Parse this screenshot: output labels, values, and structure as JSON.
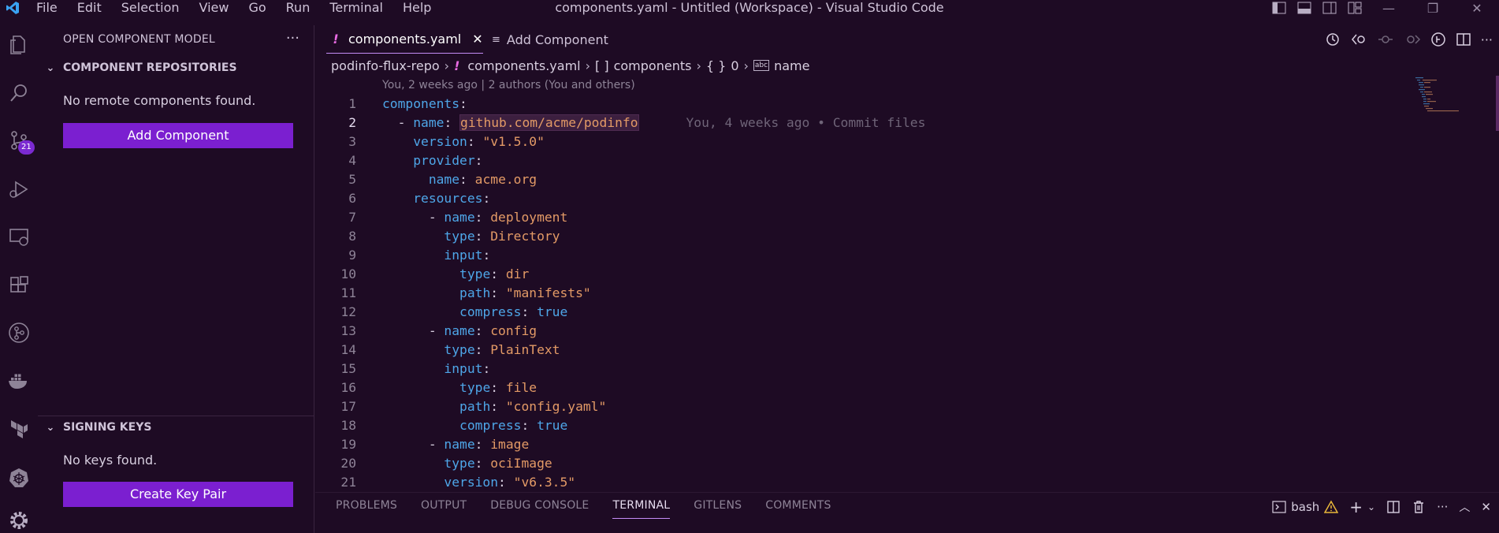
{
  "titlebar": {
    "menu": [
      "File",
      "Edit",
      "Selection",
      "View",
      "Go",
      "Run",
      "Terminal",
      "Help"
    ],
    "window_title": "components.yaml - Untitled (Workspace) - Visual Studio Code"
  },
  "activity_bar": {
    "icons": [
      "explorer-icon",
      "search-icon",
      "source-control-icon",
      "run-debug-icon",
      "remote-explorer-icon",
      "extensions-icon",
      "gitlens-icon",
      "docker-icon",
      "terraform-icon",
      "kubernetes-icon",
      "settings-gear-icon"
    ],
    "scm_badge": "21"
  },
  "sidebar": {
    "title": "OPEN COMPONENT MODEL",
    "more": "···",
    "repos": {
      "header": "COMPONENT REPOSITORIES",
      "empty_message": "No remote components found.",
      "button": "Add Component"
    },
    "keys": {
      "header": "SIGNING KEYS",
      "empty_message": "No keys found.",
      "button": "Create Key Pair"
    }
  },
  "editor": {
    "tabs": [
      {
        "label": "components.yaml",
        "marker": "!"
      },
      {
        "label": "Add Component"
      }
    ],
    "breadcrumb": {
      "repo": "podinfo-flux-repo",
      "file_marker": "!",
      "file": "components.yaml",
      "arr_icon": "[ ]",
      "arr": "components",
      "obj_icon": "{ }",
      "idx": "0",
      "field_icon": "abc",
      "field": "name"
    },
    "blame_header": "You, 2 weeks ago | 2 authors (You and others)",
    "inline_blame": "You, 4 weeks ago • Commit files",
    "line_numbers": [
      "1",
      "2",
      "3",
      "4",
      "5",
      "6",
      "7",
      "8",
      "9",
      "10",
      "11",
      "12",
      "13",
      "14",
      "15",
      "16",
      "17",
      "18",
      "19",
      "20",
      "21"
    ],
    "code": {
      "l1_key": "components",
      "l2_key": "name",
      "l2_val": "github.com/acme/podinfo",
      "l3_key": "version",
      "l3_val": "\"v1.5.0\"",
      "l4_key": "provider",
      "l5_key": "name",
      "l5_val": "acme.org",
      "l6_key": "resources",
      "l7_key": "name",
      "l7_val": "deployment",
      "l8_key": "type",
      "l8_val": "Directory",
      "l9_key": "input",
      "l10_key": "type",
      "l10_val": "dir",
      "l11_key": "path",
      "l11_val": "\"manifests\"",
      "l12_key": "compress",
      "l12_val": "true",
      "l13_key": "name",
      "l13_val": "config",
      "l14_key": "type",
      "l14_val": "PlainText",
      "l15_key": "input",
      "l16_key": "type",
      "l16_val": "file",
      "l17_key": "path",
      "l17_val": "\"config.yaml\"",
      "l18_key": "compress",
      "l18_val": "true",
      "l19_key": "name",
      "l19_val": "image",
      "l20_key": "type",
      "l20_val": "ociImage",
      "l21_key": "version",
      "l21_val": "\"v6.3.5\""
    }
  },
  "panel": {
    "tabs": [
      "PROBLEMS",
      "OUTPUT",
      "DEBUG CONSOLE",
      "TERMINAL",
      "GITLENS",
      "COMMENTS"
    ],
    "active_tab": "TERMINAL",
    "terminal_name": "bash"
  },
  "colors": {
    "background": "#1e0b24",
    "accent_button": "#7b1fd0",
    "yaml_key": "#4ea6e8",
    "yaml_value": "#e39a66"
  }
}
